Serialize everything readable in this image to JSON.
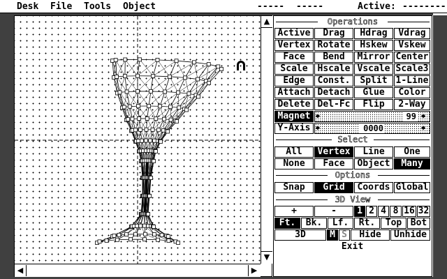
{
  "menu": {
    "items": [
      "Desk",
      "File",
      "Tools",
      "Object"
    ],
    "status_a": "-----",
    "status_b": "-----",
    "active_label": "Active:",
    "active_value": "--------"
  },
  "operations": {
    "title": "Operations",
    "rows": [
      [
        "Active",
        "Drag",
        "Hdrag",
        "Vdrag"
      ],
      [
        "Vertex",
        "Rotate",
        "Hskew",
        "Vskew"
      ],
      [
        "Face",
        "Bend",
        "Mirror",
        "Center"
      ],
      [
        "Scale",
        "Hscale",
        "Vscale",
        "Scale3"
      ],
      [
        "Edge",
        "Const.",
        "Split",
        "1-Line"
      ],
      [
        "Attach",
        "Detach",
        "Glue",
        "Color"
      ],
      [
        "Delete",
        "Del-Fc",
        "Flip",
        "2-Way"
      ]
    ],
    "magnet_label": "Magnet",
    "magnet_value": "99",
    "yaxis_label": "Y-Axis",
    "yaxis_value": "0000"
  },
  "select": {
    "title": "Select",
    "row1": [
      "All",
      "Vertex",
      "Line",
      "One"
    ],
    "row2": [
      "None",
      "Face",
      "Object",
      "Many"
    ],
    "active1": "Vertex",
    "active2": "Many"
  },
  "options": {
    "title": "Options",
    "items": [
      "Snap",
      "Grid",
      "Coords",
      "Global"
    ],
    "active": "Grid"
  },
  "view3d": {
    "title": "3D View",
    "plus": "+",
    "minus": "-",
    "zooms": [
      "1",
      "2",
      "4",
      "8",
      "16",
      "32"
    ],
    "active_zoom": "1",
    "views": [
      "Ft.",
      "Bk.",
      "Lf.",
      "Rt.",
      "Top",
      "Bot"
    ],
    "active_view": "Ft.",
    "mode_3d": "3D",
    "m": "M",
    "s": "S",
    "hide": "Hide",
    "unhide": "Unhide",
    "exit": "Exit"
  },
  "icons": {
    "magnet": "magnet-icon",
    "up": "arrow-up-icon",
    "down": "arrow-down-icon",
    "left": "arrow-left-icon",
    "right": "arrow-right-icon"
  }
}
